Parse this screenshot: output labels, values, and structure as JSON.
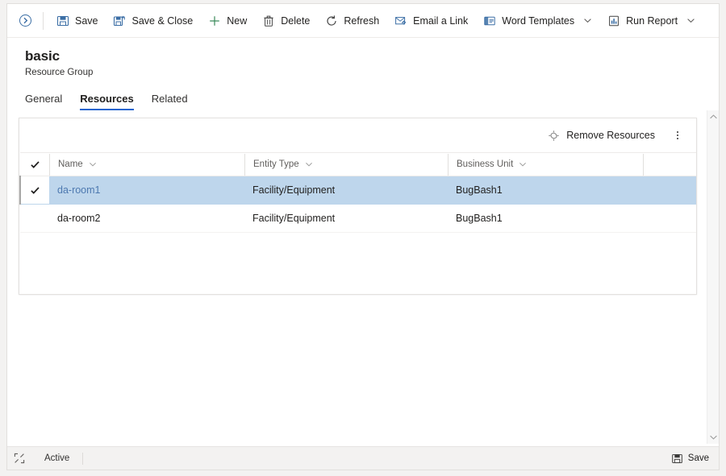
{
  "theme": {
    "accent": "#2564cf",
    "link": "#4f7bb5",
    "selected_row_bg": "#bed6ec",
    "border": "#e1dfdd",
    "page_bg": "#f3f2f1",
    "icon_blue": "#3b6ea5",
    "icon_green": "#3b8a5b"
  },
  "commandbar": {
    "collapse_icon": "chevron-circle-right-icon",
    "buttons": [
      {
        "label": "Save",
        "icon": "save-icon",
        "caret": false
      },
      {
        "label": "Save & Close",
        "icon": "save-and-close-icon",
        "caret": false
      },
      {
        "label": "New",
        "icon": "plus-icon",
        "caret": false
      },
      {
        "label": "Delete",
        "icon": "trash-icon",
        "caret": false
      },
      {
        "label": "Refresh",
        "icon": "refresh-icon",
        "caret": false
      },
      {
        "label": "Email a Link",
        "icon": "email-link-icon",
        "caret": false
      },
      {
        "label": "Word Templates",
        "icon": "word-template-icon",
        "caret": true
      },
      {
        "label": "Run Report",
        "icon": "report-icon",
        "caret": true
      }
    ]
  },
  "header": {
    "title": "basic",
    "subtitle": "Resource Group"
  },
  "tabs": [
    {
      "label": "General",
      "active": false
    },
    {
      "label": "Resources",
      "active": true
    },
    {
      "label": "Related",
      "active": false
    }
  ],
  "grid": {
    "commands": {
      "remove_label": "Remove Resources",
      "remove_icon": "remove-link-icon",
      "overflow_icon": "more-vertical-icon"
    },
    "select_all_icon": "checkmark-icon",
    "columns": [
      {
        "label": "Name",
        "sortable": true
      },
      {
        "label": "Entity Type",
        "sortable": true
      },
      {
        "label": "Business Unit",
        "sortable": true
      }
    ],
    "rows": [
      {
        "selected": true,
        "check_icon": "checkmark-icon",
        "name": "da-room1",
        "entity_type": "Facility/Equipment",
        "business_unit": "BugBash1"
      },
      {
        "selected": false,
        "check_icon": "",
        "name": "da-room2",
        "entity_type": "Facility/Equipment",
        "business_unit": "BugBash1"
      }
    ]
  },
  "scrollbar": {
    "up_icon": "caret-up-icon",
    "down_icon": "caret-down-icon"
  },
  "footer": {
    "left_icon": "expand-icon",
    "status": "Active",
    "save_label": "Save",
    "save_icon": "save-icon"
  }
}
